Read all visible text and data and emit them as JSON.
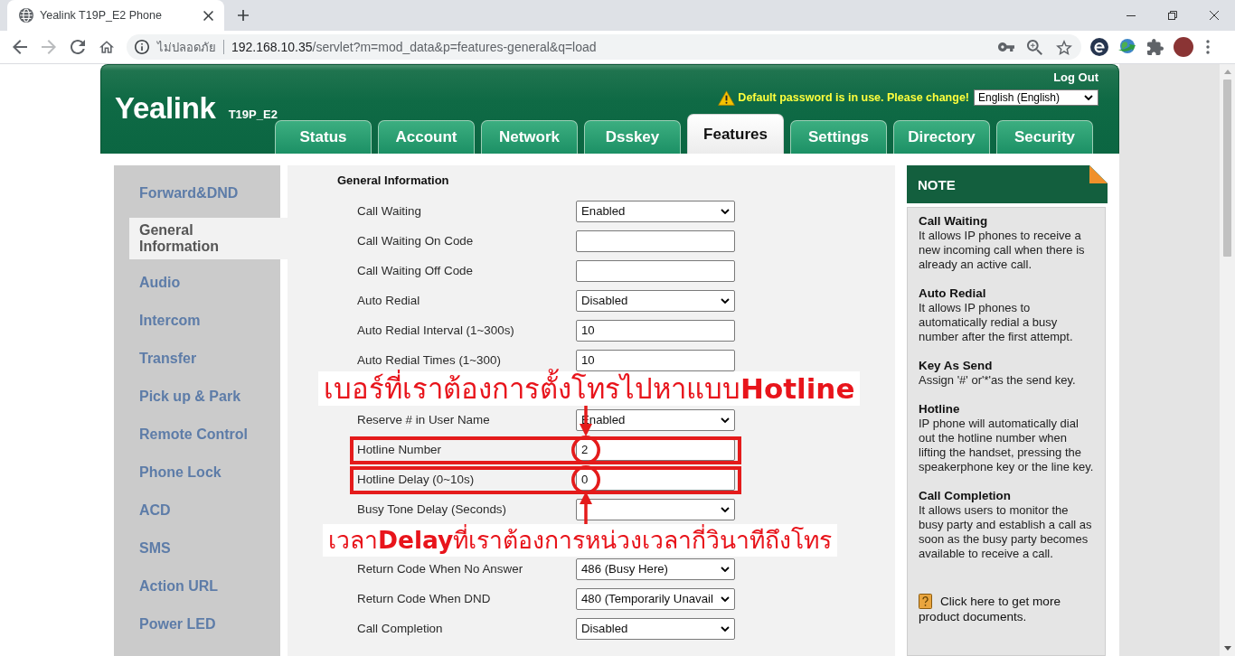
{
  "browser": {
    "tabs": [
      {
        "title": "Yealink T19P_E2 Phone",
        "selected": true
      }
    ],
    "nav_buttons": [
      {
        "kind": "back",
        "disabled": false
      },
      {
        "kind": "forward",
        "disabled": true
      },
      {
        "kind": "reload",
        "disabled": false
      },
      {
        "kind": "home",
        "disabled": false
      }
    ],
    "address_bar": {
      "security_label": "ไม่ปลอดภัย",
      "host": "192.168.10.35",
      "path": "/servlet?m=mod_data&p=features-general&q=load"
    }
  },
  "header": {
    "logo": "Yealink",
    "model": "T19P_E2",
    "logout": "Log Out",
    "warning": "Default password is in use. Please change!",
    "language": "English (English)",
    "tabs": [
      {
        "label": "Status",
        "selected": false
      },
      {
        "label": "Account",
        "selected": false
      },
      {
        "label": "Network",
        "selected": false
      },
      {
        "label": "Dsskey",
        "selected": false
      },
      {
        "label": "Features",
        "selected": true
      },
      {
        "label": "Settings",
        "selected": false
      },
      {
        "label": "Directory",
        "selected": false
      },
      {
        "label": "Security",
        "selected": false
      }
    ]
  },
  "sidebar": {
    "items": [
      {
        "label": "Forward&DND",
        "selected": false
      },
      {
        "label": "General Information",
        "selected": true
      },
      {
        "label": "Audio",
        "selected": false
      },
      {
        "label": "Intercom",
        "selected": false
      },
      {
        "label": "Transfer",
        "selected": false
      },
      {
        "label": "Pick up & Park",
        "selected": false
      },
      {
        "label": "Remote Control",
        "selected": false
      },
      {
        "label": "Phone Lock",
        "selected": false
      },
      {
        "label": "ACD",
        "selected": false
      },
      {
        "label": "SMS",
        "selected": false
      },
      {
        "label": "Action URL",
        "selected": false
      },
      {
        "label": "Power LED",
        "selected": false
      }
    ]
  },
  "form": {
    "title": "General Information",
    "rows": [
      {
        "kind": "select",
        "label": "Call Waiting",
        "value": "Enabled",
        "highlighted": false
      },
      {
        "kind": "text",
        "label": "Call Waiting On Code",
        "highlighted": false
      },
      {
        "kind": "text",
        "label": "Call Waiting Off Code",
        "highlighted": false
      },
      {
        "kind": "select",
        "label": "Auto Redial",
        "value": "Disabled",
        "highlighted": false
      },
      {
        "kind": "text",
        "label": "Auto Redial Interval (1~300s)",
        "value": "10",
        "highlighted": false
      },
      {
        "kind": "text",
        "label": "Auto Redial Times (1~300)",
        "value": "10",
        "highlighted": false
      },
      {
        "kind": "callout",
        "text": "เบอร์ที่เราต้องการตั้งโทรไปหาแบบ**Hotline**",
        "highlighted": false
      },
      {
        "kind": "select",
        "label": "Reserve # in User Name",
        "value": "Enabled",
        "highlighted": false
      },
      {
        "kind": "text",
        "label": "Hotline Number",
        "value": "2",
        "highlighted": true
      },
      {
        "kind": "text",
        "label": "Hotline Delay (0~10s)",
        "value": "0",
        "highlighted": true
      },
      {
        "kind": "select",
        "label": "Busy Tone Delay (Seconds)",
        "highlighted": false
      },
      {
        "kind": "callout",
        "text": "เวลา**Delay**ที่เราต้องการหน่วงเวลากี่วินาทีถึงโทร",
        "highlighted": false
      },
      {
        "kind": "select",
        "label": "Return Code When No Answer",
        "value": "486 (Busy Here)",
        "highlighted": false
      },
      {
        "kind": "select",
        "label": "Return Code When DND",
        "value": "480 (Temporarily Unavail",
        "highlighted": false
      },
      {
        "kind": "select",
        "label": "Call Completion",
        "value": "Disabled",
        "highlighted": false
      }
    ]
  },
  "note": {
    "title": "NOTE",
    "items": [
      {
        "title": "Call Waiting",
        "text": "It allows IP phones to receive a new incoming call when there is already an active call."
      },
      {
        "title": "Auto Redial",
        "text": "It allows IP phones to automatically redial a busy number after the first attempt."
      },
      {
        "title": "Key As Send",
        "text": "Assign '#' or'*'as the send key."
      },
      {
        "title": "Hotline",
        "text": "IP phone will automatically dial out the hotline number when lifting the handset, pressing the speakerphone key or the line key."
      },
      {
        "title": "Call Completion",
        "text": "It allows users to monitor the busy party and establish a call as soon as the busy party becomes available to receive a call."
      }
    ],
    "link": "Click here to get more product documents."
  }
}
